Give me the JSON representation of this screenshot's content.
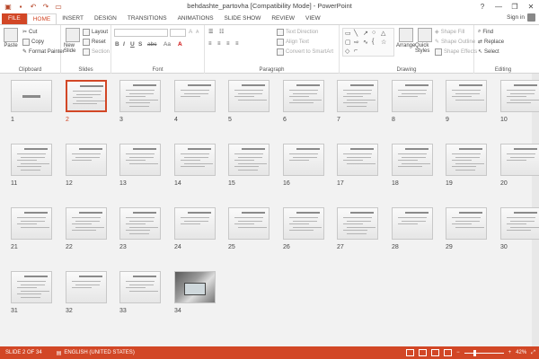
{
  "window": {
    "title": "behdashte_partovha [Compatibility Mode] - PowerPoint",
    "controls": [
      "?",
      "—",
      "❐",
      "✕"
    ]
  },
  "qat": [
    "save-icon",
    "undo-icon",
    "redo-icon",
    "present-icon"
  ],
  "tabs": [
    "FILE",
    "HOME",
    "INSERT",
    "DESIGN",
    "TRANSITIONS",
    "ANIMATIONS",
    "SLIDE SHOW",
    "REVIEW",
    "VIEW"
  ],
  "active_tab": "HOME",
  "signin": "Sign in",
  "ribbon": {
    "clipboard": {
      "label": "Clipboard",
      "paste": "Paste",
      "cut": "Cut",
      "copy": "Copy",
      "format_painter": "Format Painter"
    },
    "slides": {
      "label": "Slides",
      "new_slide": "New Slide",
      "layout": "Layout",
      "reset": "Reset",
      "section": "Section"
    },
    "font": {
      "label": "Font",
      "bold": "B",
      "italic": "I",
      "underline": "U",
      "strike": "S",
      "aa": "Aa"
    },
    "paragraph": {
      "label": "Paragraph",
      "text_direction": "Text Direction",
      "align_text": "Align Text",
      "smartart": "Convert to SmartArt"
    },
    "drawing": {
      "label": "Drawing",
      "arrange": "Arrange",
      "quick_styles": "Quick Styles",
      "shape_fill": "Shape Fill",
      "shape_outline": "Shape Outline",
      "shape_effects": "Shape Effects"
    },
    "editing": {
      "label": "Editing",
      "find": "Find",
      "replace": "Replace",
      "select": "Select"
    }
  },
  "slides": {
    "selected": 2,
    "count": 34,
    "labels": [
      "1",
      "2",
      "3",
      "4",
      "5",
      "6",
      "7",
      "8",
      "9",
      "10",
      "11",
      "12",
      "13",
      "14",
      "15",
      "16",
      "17",
      "18",
      "19",
      "20",
      "21",
      "22",
      "23",
      "24",
      "25",
      "26",
      "27",
      "28",
      "29",
      "30",
      "31",
      "32",
      "33",
      "34"
    ]
  },
  "status": {
    "slide_info": "SLIDE 2 OF 34",
    "language": "ENGLISH (UNITED STATES)",
    "zoom": "42%"
  },
  "colors": {
    "accent": "#d24726"
  }
}
